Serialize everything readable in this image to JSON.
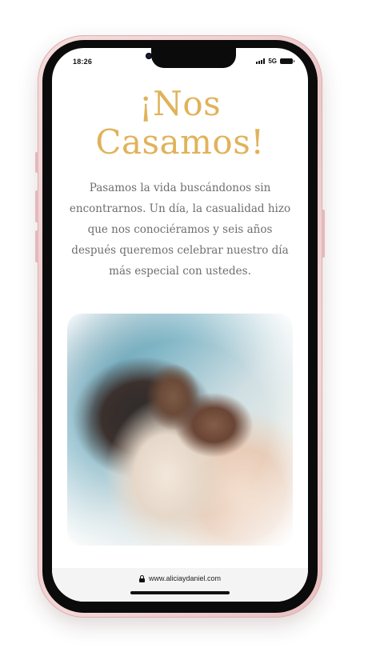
{
  "status_bar": {
    "time": "18:26",
    "network": "5G"
  },
  "page": {
    "headline_line1": "¡Nos",
    "headline_line2": "Casamos!",
    "intro_text": "Pasamos la vida buscándonos sin encontrarnos. Un día, la casualidad hizo que nos conociéramos y seis años después queremos celebrar nuestro día más especial con ustedes."
  },
  "browser": {
    "url": "www.aliciaydaniel.com",
    "lock_icon": "lock-icon"
  },
  "colors": {
    "accent": "#e0b35a",
    "body_text": "#6e6e6e",
    "phone_frame": "#edc8c9"
  }
}
